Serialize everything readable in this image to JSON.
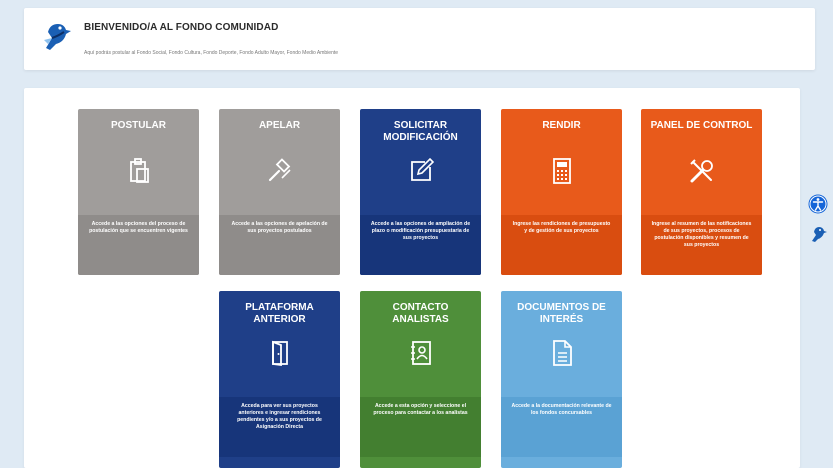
{
  "header": {
    "title": "BIENVENIDO/A AL FONDO COMUNIDAD",
    "subtitle": "Aquí podrás postular al Fondo Social, Fondo Cultura, Fondo Deporte, Fondo Adulto Mayor, Fondo Medio Ambiente"
  },
  "cards": [
    {
      "title": "POSTULAR",
      "icon": "clipboard-icon",
      "color": "#a09d9b",
      "desc_color": "#8f8c8a",
      "desc": "Accede a las opciones del proceso de postulación que se encuentren vigentes"
    },
    {
      "title": "APELAR",
      "icon": "gavel-icon",
      "color": "#a09d9b",
      "desc_color": "#8f8c8a",
      "desc": "Accede a las opciones de apelación de sus proyectos postulados"
    },
    {
      "title": "SOLICITAR MODIFICACIÓN",
      "icon": "edit-icon",
      "color": "#1f3f88",
      "desc_color": "#17357a",
      "desc": "Accede a las opciones de ampliación de plazo o modificación presupuestaria de sus proyectos"
    },
    {
      "title": "RENDIR",
      "icon": "calculator-icon",
      "color": "#e85a1b",
      "desc_color": "#d94d10",
      "desc": "Ingrese las rendiciones de presupuesto y de gestión de sus proyectos"
    },
    {
      "title": "PANEL DE CONTROL",
      "icon": "tools-icon",
      "color": "#e85a1b",
      "desc_color": "#d94d10",
      "desc": "Ingrese al resumen de las notificaciones de sus proyectos, procesos de postulación disponibles y resumen de sus proyectos"
    },
    {
      "title": "PLATAFORMA ANTERIOR",
      "icon": "door-icon",
      "color": "#1f3f88",
      "desc_color": "#17357a",
      "desc": "Acceda para ver sus proyectos anteriores e ingresar rendiciones pendientes y/o a sus proyectos de Asignación Directa"
    },
    {
      "title": "CONTACTO ANALISTAS",
      "icon": "contact-book-icon",
      "color": "#4f8f3a",
      "desc_color": "#437f30",
      "desc": "Accede a esta opción y seleccione el proceso para contactar a los analistas"
    },
    {
      "title": "DOCUMENTOS DE INTERÉS",
      "icon": "document-icon",
      "color": "#6aaedd",
      "desc_color": "#5aa2d4",
      "desc": "Accede a la documentación relevante de los fondos concursables"
    }
  ],
  "side": {
    "accessibility_icon": "accessibility-icon",
    "accessibility_color": "#1565d8",
    "bird_icon": "bird-logo-icon"
  }
}
